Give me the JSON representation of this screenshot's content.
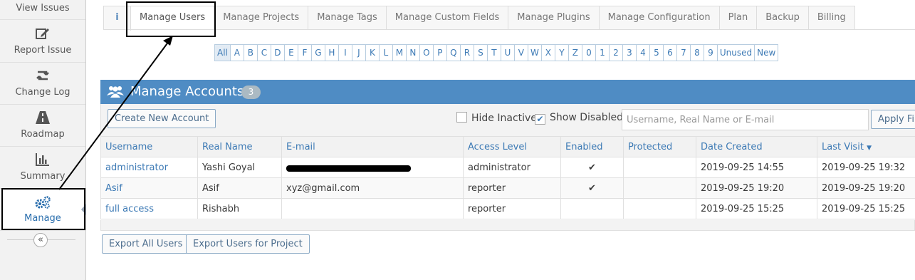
{
  "sidebar": {
    "items": [
      {
        "label": "View Issues",
        "icon": "list-icon"
      },
      {
        "label": "Report Issue",
        "icon": "edit-icon"
      },
      {
        "label": "Change Log",
        "icon": "retweet-icon"
      },
      {
        "label": "Roadmap",
        "icon": "road-icon"
      },
      {
        "label": "Summary",
        "icon": "bar-chart-icon"
      },
      {
        "label": "Manage",
        "icon": "gears-icon",
        "active": true
      }
    ],
    "collapse_glyph": "«"
  },
  "tabs": {
    "info_glyph": "i",
    "items": [
      "Manage Users",
      "Manage Projects",
      "Manage Tags",
      "Manage Custom Fields",
      "Manage Plugins",
      "Manage Configuration",
      "Plan",
      "Backup",
      "Billing"
    ],
    "active": "Manage Users"
  },
  "filters": [
    "All",
    "A",
    "B",
    "C",
    "D",
    "E",
    "F",
    "G",
    "H",
    "I",
    "J",
    "K",
    "L",
    "M",
    "N",
    "O",
    "P",
    "Q",
    "R",
    "S",
    "T",
    "U",
    "V",
    "W",
    "X",
    "Y",
    "Z",
    "0",
    "1",
    "2",
    "3",
    "4",
    "5",
    "6",
    "7",
    "8",
    "9",
    "Unused",
    "New"
  ],
  "panel": {
    "title": "Manage Accounts",
    "count": "3",
    "create_button": "Create New Account",
    "hide_inactive": "Hide Inactive",
    "show_disabled": "Show Disabled",
    "search_placeholder": "Username, Real Name or E-mail",
    "apply_filter": "Apply Filter"
  },
  "table": {
    "columns": [
      "Username",
      "Real Name",
      "E-mail",
      "Access Level",
      "Enabled",
      "Protected",
      "Date Created",
      "Last Visit"
    ],
    "sort_glyph": "▼",
    "check_glyph": "✔",
    "rows": [
      {
        "username": "administrator",
        "real_name": "Yashi Goyal",
        "email": "",
        "access": "administrator",
        "enabled": true,
        "protected": false,
        "created": "2019-09-25 14:55",
        "last_visit": "2019-09-25 19:32"
      },
      {
        "username": "Asif",
        "real_name": "Asif",
        "email": "xyz@gmail.com",
        "access": "reporter",
        "enabled": true,
        "protected": false,
        "created": "2019-09-25 19:20",
        "last_visit": "2019-09-25 19:20"
      },
      {
        "username": "full access",
        "real_name": "Rishabh",
        "email": "",
        "access": "reporter",
        "enabled": false,
        "protected": false,
        "created": "2019-09-25 15:25",
        "last_visit": "2019-09-25 15:25"
      }
    ]
  },
  "export": {
    "all_users": "Export All Users",
    "for_project": "Export Users for Project"
  },
  "colors": {
    "accent": "#3d7ab5",
    "panel_header": "#4f8cc4",
    "annotation": "#000000"
  }
}
